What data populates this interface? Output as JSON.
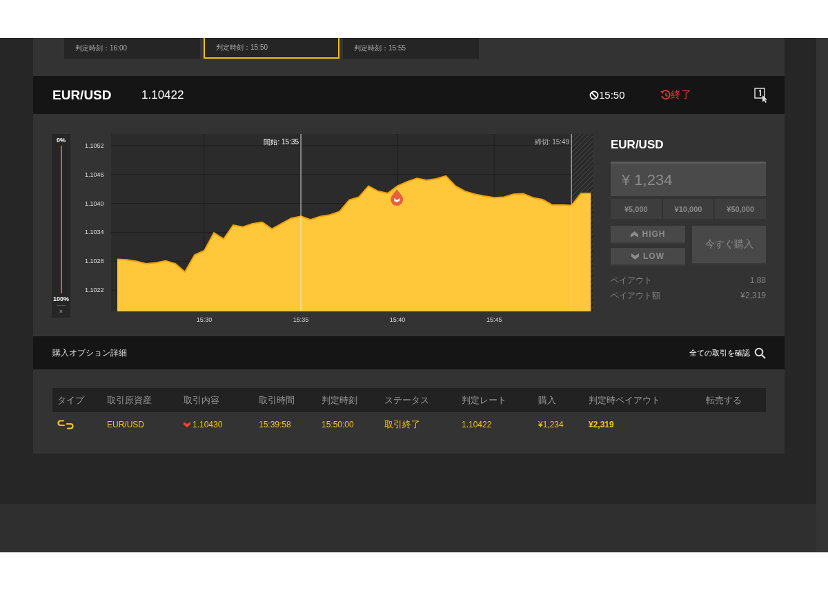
{
  "expiry_cards": [
    {
      "label": "判定時刻：16:00",
      "selected": false
    },
    {
      "label": "判定時刻：15:50",
      "selected": true
    },
    {
      "label": "判定時刻：15:55",
      "selected": false
    }
  ],
  "header": {
    "symbol": "EUR/USD",
    "price": "1.10422",
    "expiry": "15:50",
    "status": "終了"
  },
  "zoom_bar": {
    "top_label": "0%",
    "bottom_label": "100%",
    "close": "×"
  },
  "chart": {
    "chart_data": {
      "type": "area",
      "categories": [
        null,
        null,
        null,
        null,
        null,
        null,
        null,
        null,
        null,
        "15:30",
        null,
        null,
        null,
        null,
        null,
        null,
        null,
        null,
        null,
        "15:35",
        null,
        null,
        null,
        null,
        null,
        null,
        null,
        null,
        null,
        "15:40",
        null,
        null,
        null,
        null,
        null,
        null,
        null,
        null,
        null,
        "15:45",
        null,
        null,
        null,
        null,
        null,
        null,
        null,
        null,
        null,
        null
      ],
      "series": [
        {
          "color": "#ffc83a",
          "values": [
            1.10284,
            1.10283,
            1.1028,
            1.10275,
            1.10277,
            1.10281,
            1.10275,
            1.10258,
            1.10293,
            1.10302,
            1.10339,
            1.10326,
            1.10355,
            1.10351,
            1.10358,
            1.10361,
            1.10347,
            1.10358,
            1.10369,
            1.10373,
            1.10366,
            1.10373,
            1.10376,
            1.10383,
            1.10407,
            1.10413,
            1.10436,
            1.10425,
            1.10421,
            1.10436,
            1.10445,
            1.10452,
            1.10448,
            1.10451,
            1.10457,
            1.10436,
            1.10425,
            1.10419,
            1.10415,
            1.10412,
            1.10413,
            1.10419,
            1.1042,
            1.10412,
            1.10408,
            1.10397,
            1.10397,
            1.10396,
            1.10421,
            1.10421
          ]
        }
      ],
      "ylim": [
        1.10176,
        1.10544
      ],
      "yticks": [
        {
          "value": 1.1022,
          "label": "1.1022"
        },
        {
          "value": 1.1028,
          "label": "1.1028"
        },
        {
          "value": 1.1034,
          "label": "1.1034"
        },
        {
          "value": 1.104,
          "label": "1.1040"
        },
        {
          "value": 1.1046,
          "label": "1.1046"
        },
        {
          "value": 1.1052,
          "label": "1.1052"
        }
      ],
      "grid": true,
      "ref_lines": [
        {
          "label": "開始: 15:35"
        },
        {
          "label": "締切: 15:49"
        }
      ]
    },
    "closed_after_last_line": true
  },
  "order_panel": {
    "symbol": "EUR/USD",
    "amount": "¥ 1,234",
    "quick_amounts": [
      "¥5,000",
      "¥10,000",
      "¥50,000"
    ],
    "high": {
      "label": "HIGH",
      "disabled": true
    },
    "low": {
      "label": "LOW",
      "disabled": true
    },
    "buy": {
      "label": "今すぐ購入",
      "disabled": true
    },
    "info": [
      {
        "label": "ペイアウト",
        "value": "1.88"
      },
      {
        "label": "ペイアウト額",
        "value": "¥2,319"
      }
    ]
  },
  "details": {
    "title": "購入オプション詳細",
    "link": "全ての取引を確認",
    "columns": [
      "タイプ",
      "取引原資産",
      "取引内容",
      "取引時間",
      "判定時刻",
      "ステータス",
      "判定レート",
      "購入",
      "判定時ペイアウト",
      "転売する"
    ],
    "rows": [
      {
        "asset": "EUR/USD",
        "kind": "low",
        "strike": "1.10430",
        "trade_time": "15:39:58",
        "expiry_time": "15:50:00",
        "status": "取引終了",
        "rate": "1.10422",
        "purchase": "¥1,234",
        "payout": "¥2,319"
      }
    ]
  }
}
